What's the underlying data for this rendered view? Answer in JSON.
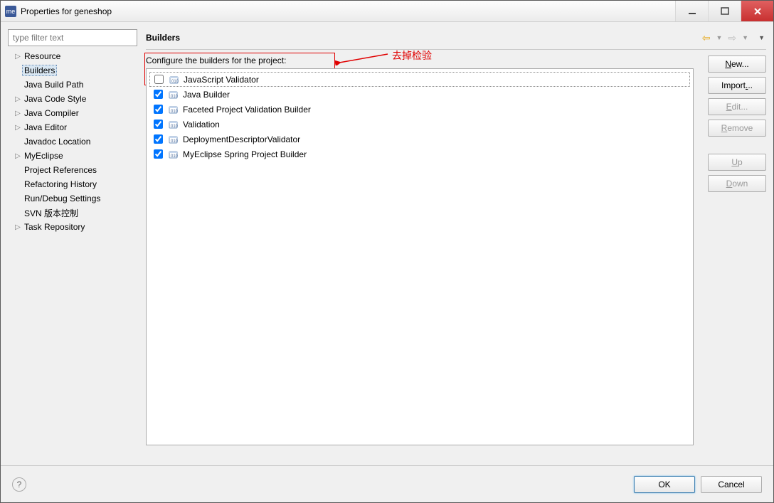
{
  "title": "Properties for geneshop",
  "filter_placeholder": "type filter text",
  "tree": [
    {
      "label": "Resource",
      "expandable": true
    },
    {
      "label": "Builders",
      "expandable": false,
      "selected": true
    },
    {
      "label": "Java Build Path",
      "expandable": false
    },
    {
      "label": "Java Code Style",
      "expandable": true
    },
    {
      "label": "Java Compiler",
      "expandable": true
    },
    {
      "label": "Java Editor",
      "expandable": true
    },
    {
      "label": "Javadoc Location",
      "expandable": false
    },
    {
      "label": "MyEclipse",
      "expandable": true
    },
    {
      "label": "Project References",
      "expandable": false
    },
    {
      "label": "Refactoring History",
      "expandable": false
    },
    {
      "label": "Run/Debug Settings",
      "expandable": false
    },
    {
      "label": "SVN 版本控制",
      "expandable": false
    },
    {
      "label": "Task Repository",
      "expandable": true
    }
  ],
  "main_title": "Builders",
  "conf_label": "Configure the builders for the project:",
  "builders": [
    {
      "label": "JavaScript Validator",
      "checked": false,
      "highlight": true
    },
    {
      "label": "Java Builder",
      "checked": true
    },
    {
      "label": "Faceted Project Validation Builder",
      "checked": true
    },
    {
      "label": "Validation",
      "checked": true
    },
    {
      "label": "DeploymentDescriptorValidator",
      "checked": true
    },
    {
      "label": "MyEclipse Spring Project Builder",
      "checked": true
    }
  ],
  "annotation_text": "去掉检验",
  "buttons": {
    "new": "New...",
    "import": "Import...",
    "edit": "Edit...",
    "remove": "Remove",
    "up": "Up",
    "down": "Down",
    "ok": "OK",
    "cancel": "Cancel"
  }
}
